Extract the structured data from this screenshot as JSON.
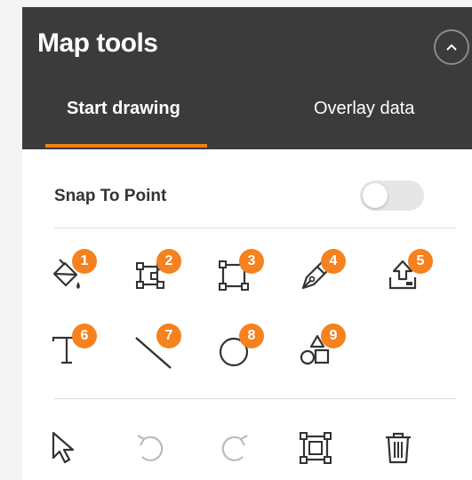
{
  "panel": {
    "title": "Map tools",
    "collapse_icon": "chevron-up-icon"
  },
  "tabs": [
    {
      "label": "Start drawing",
      "active": true
    },
    {
      "label": "Overlay data",
      "active": false
    }
  ],
  "snap": {
    "label": "Snap To Point",
    "enabled": false
  },
  "tools": [
    {
      "badge": "1",
      "icon": "paint-bucket-icon"
    },
    {
      "badge": "2",
      "icon": "polygon-edit-icon"
    },
    {
      "badge": "3",
      "icon": "rectangle-icon"
    },
    {
      "badge": "4",
      "icon": "pen-icon"
    },
    {
      "badge": "5",
      "icon": "upload-icon"
    },
    {
      "badge": "6",
      "icon": "text-icon"
    },
    {
      "badge": "7",
      "icon": "line-icon"
    },
    {
      "badge": "8",
      "icon": "circle-icon"
    },
    {
      "badge": "9",
      "icon": "shapes-icon"
    }
  ],
  "actions": [
    "pointer-icon",
    "undo-icon",
    "redo-icon",
    "select-area-icon",
    "trash-icon"
  ],
  "colors": {
    "header_bg": "#3b3b3b",
    "accent": "#f5811f",
    "icon": "#333333"
  }
}
